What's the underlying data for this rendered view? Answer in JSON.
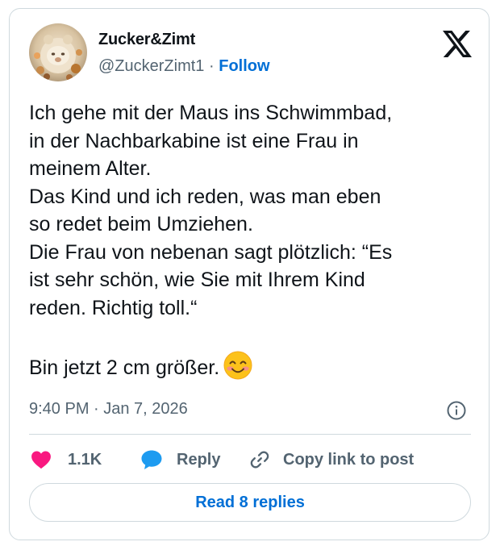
{
  "author": {
    "display_name": "Zucker&Zimt",
    "handle": "@ZuckerZimt1",
    "separator": "·",
    "follow_label": "Follow",
    "avatar_icon": "avatar-photo"
  },
  "platform_logo_icon": "x-logo",
  "tweet": {
    "lines": [
      "Ich gehe mit der Maus ins Schwimmbad,",
      "in der Nachbarkabine ist eine Frau in",
      "meinem Alter.",
      "Das Kind und ich reden, was man eben",
      "so redet beim Umziehen.",
      "Die Frau von nebenan sagt plötzlich: “Es",
      "ist sehr schön, wie Sie mit Ihrem Kind",
      "reden. Richtig toll.“",
      "",
      "Bin jetzt 2 cm größer."
    ],
    "closing_emoji": "smiling-face-with-smiling-eyes-emoji"
  },
  "timestamp": "9:40 PM · Jan 7, 2026",
  "info_icon": "info-icon",
  "actions": {
    "like_count": "1.1K",
    "like_icon": "heart-icon",
    "reply_label": "Reply",
    "reply_icon": "speech-bubble-icon",
    "copy_label": "Copy link to post",
    "copy_icon": "link-icon"
  },
  "read_replies_label": "Read 8 replies",
  "colors": {
    "link_blue": "#006fd6",
    "heart_pink": "#f91880",
    "reply_blue": "#1d9bf0",
    "muted_text": "#536471",
    "border": "#cfd9de",
    "text": "#0f1419"
  }
}
